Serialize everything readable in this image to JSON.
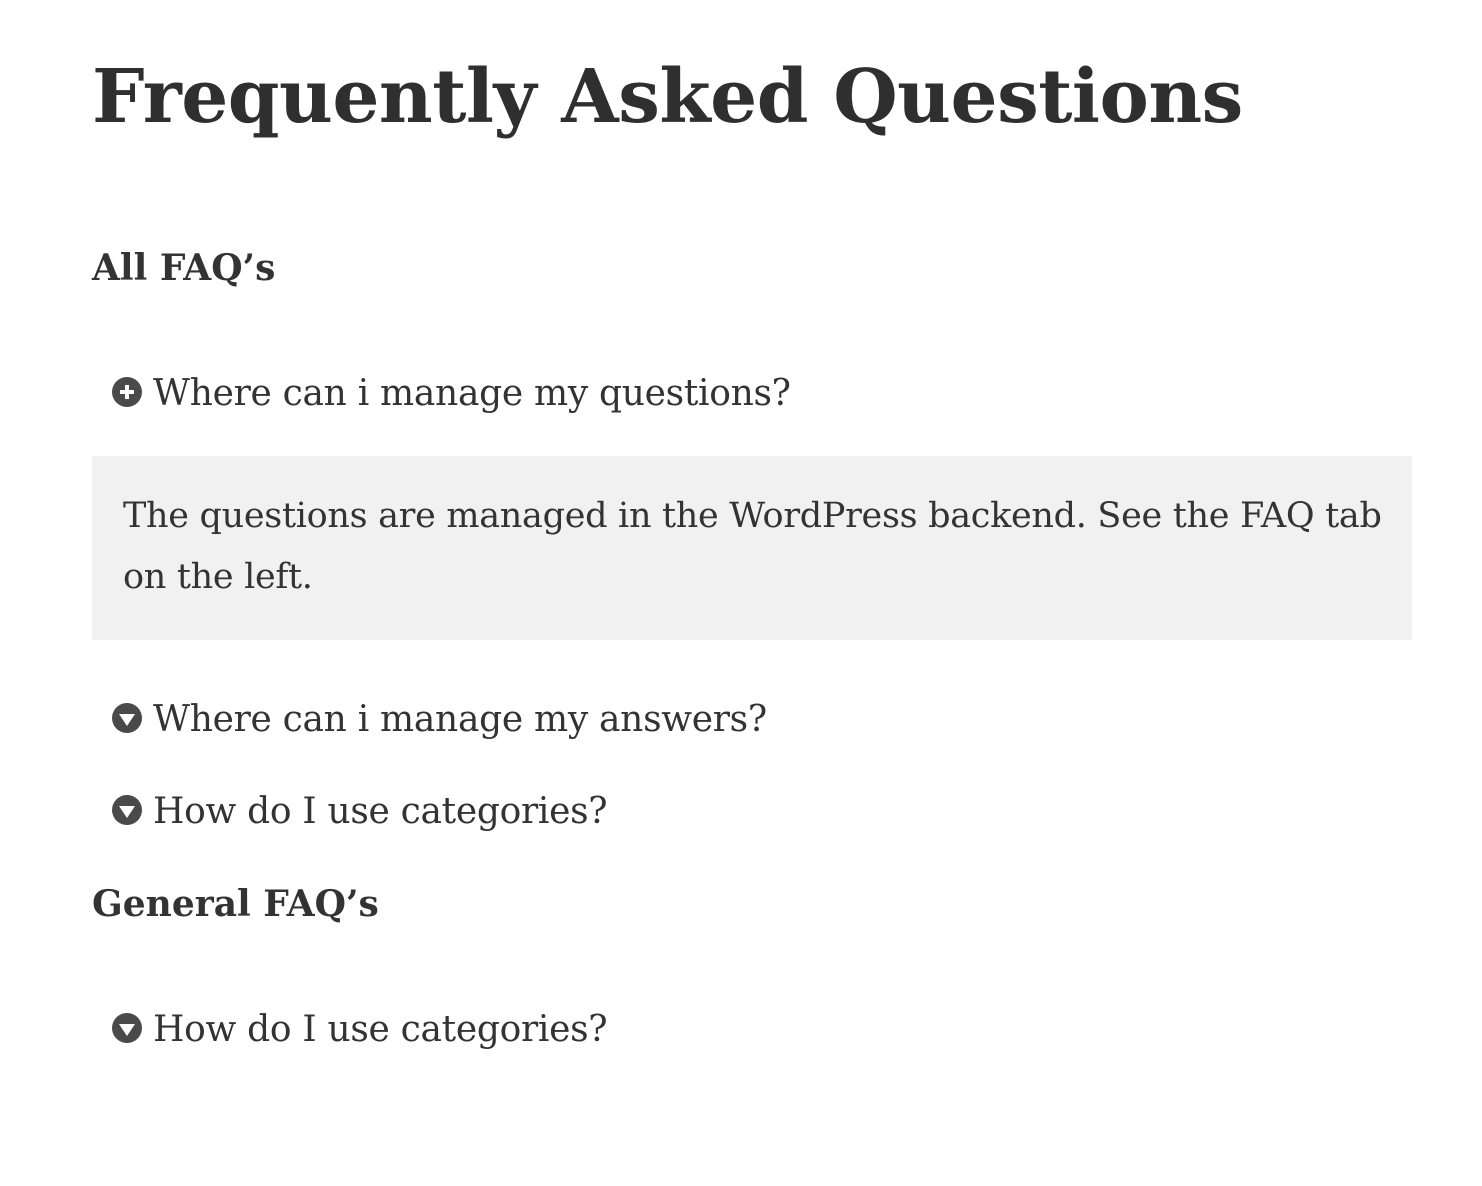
{
  "page": {
    "title": "Frequently Asked Questions"
  },
  "sections": [
    {
      "heading": "All FAQ’s",
      "items": [
        {
          "question": "Where can i manage my questions?",
          "icon": "plus-circle-icon",
          "expanded": true,
          "answer": "The questions are managed in the WordPress backend. See the FAQ tab on the left."
        },
        {
          "question": "Where can i manage my answers?",
          "icon": "chevron-down-circle-icon",
          "expanded": false
        },
        {
          "question": "How do I use categories?",
          "icon": "chevron-down-circle-icon",
          "expanded": false
        }
      ]
    },
    {
      "heading": "General FAQ’s",
      "items": [
        {
          "question": "How do I use categories?",
          "icon": "chevron-down-circle-icon",
          "expanded": false
        }
      ]
    }
  ],
  "colors": {
    "text": "#333333",
    "answer_background": "#f1f1f1",
    "icon": "#4a4a4a"
  }
}
